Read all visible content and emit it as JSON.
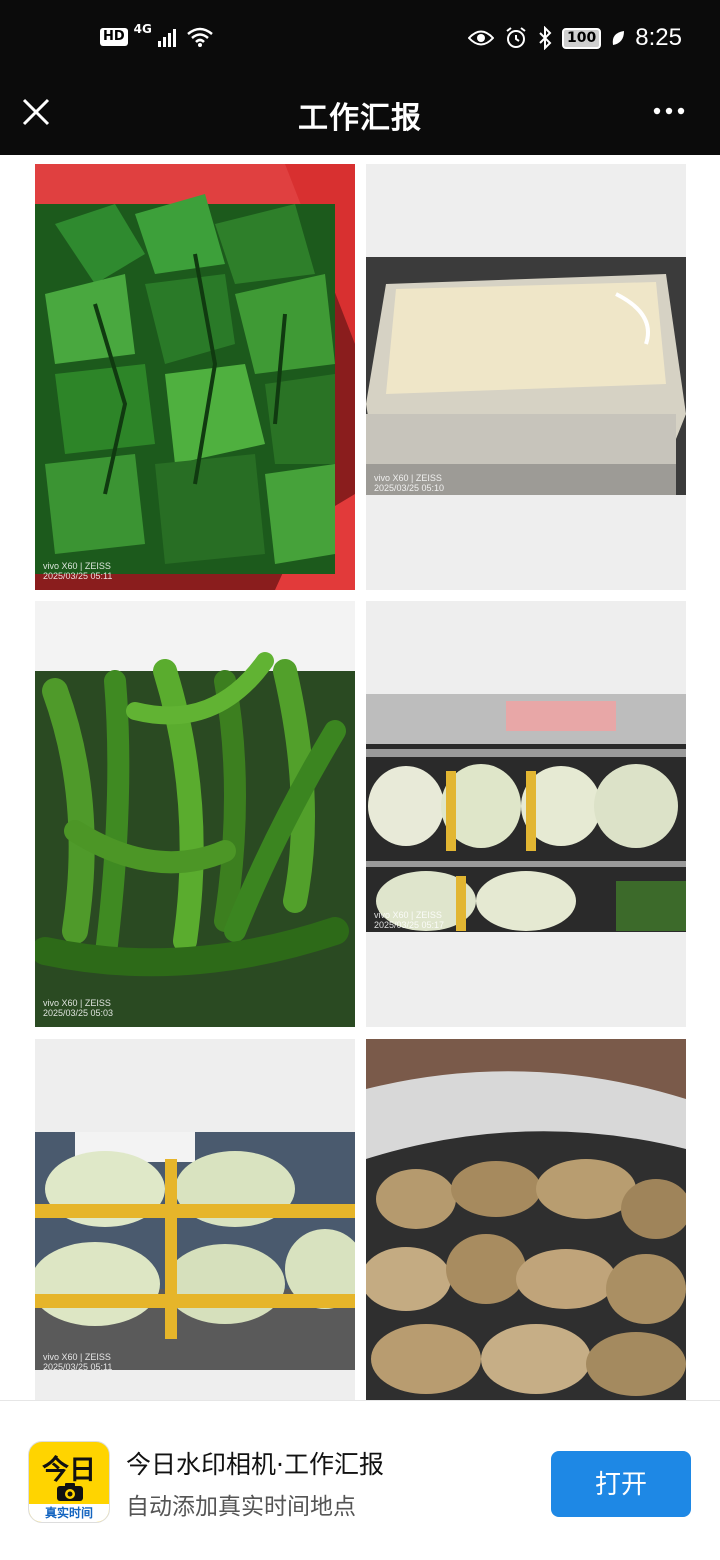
{
  "status_bar": {
    "hd_label": "HD",
    "network": "4G",
    "battery": "100",
    "time": "8:25"
  },
  "nav": {
    "title": "工作汇报"
  },
  "photos": [
    {
      "watermark_device": "vivo X60 | ZEISS",
      "watermark_time": "2025/03/25 05:11"
    },
    {
      "watermark_device": "vivo X60 | ZEISS",
      "watermark_time": "2025/03/25 05:10"
    },
    {
      "watermark_device": "vivo X60 | ZEISS",
      "watermark_time": "2025/03/25 05:03"
    },
    {
      "watermark_device": "vivo X60 | ZEISS",
      "watermark_time": "2025/03/25 05:17"
    },
    {
      "watermark_device": "vivo X60 | ZEISS",
      "watermark_time": "2025/03/25 05:11"
    },
    {
      "watermark_device": "",
      "watermark_time": ""
    }
  ],
  "banner": {
    "icon_main": "今日",
    "icon_sub": "真实时间",
    "title": "今日水印相机·工作汇报",
    "subtitle": "自动添加真实时间地点",
    "open_label": "打开"
  },
  "colors": {
    "bar_bg": "#0b0b0b",
    "accent_blue": "#1e88e5",
    "icon_yellow": "#ffd400"
  }
}
